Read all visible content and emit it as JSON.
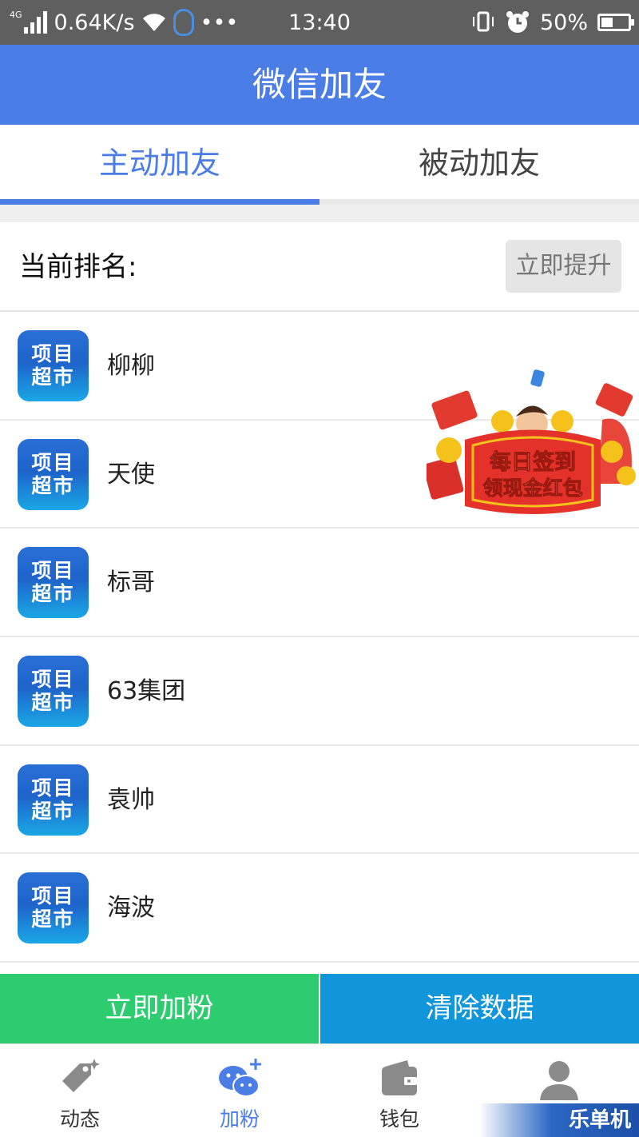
{
  "status_bar": {
    "network": "4G",
    "speed": "0.64K/s",
    "more": "•••",
    "time": "13:40",
    "battery": "50%",
    "battery_level": 0.5
  },
  "header": {
    "title": "微信加友"
  },
  "tabs": [
    {
      "label": "主动加友",
      "active": true
    },
    {
      "label": "被动加友",
      "active": false
    }
  ],
  "rank": {
    "label": "当前排名:",
    "button": "立即提升"
  },
  "list_logo_text": [
    "项目",
    "超市"
  ],
  "list": [
    {
      "name": "柳柳"
    },
    {
      "name": "天使"
    },
    {
      "name": "标哥"
    },
    {
      "name": "63集团"
    },
    {
      "name": "袁帅"
    },
    {
      "name": "海波"
    }
  ],
  "promo": {
    "line1": "每日签到",
    "line2": "领现金红包"
  },
  "actions": {
    "add_fans": "立即加粉",
    "clear_data": "清除数据"
  },
  "bottom_nav": [
    {
      "label": "动态",
      "icon": "tag-icon",
      "active": false
    },
    {
      "label": "加粉",
      "icon": "wechat-add-icon",
      "active": true
    },
    {
      "label": "钱包",
      "icon": "wallet-icon",
      "active": false
    },
    {
      "label": "",
      "icon": "person-icon",
      "active": false
    }
  ],
  "watermark": "乐单机",
  "colors": {
    "accent": "#4a7de6",
    "green": "#2dcc6f",
    "blue": "#1296db",
    "statusbar": "#5f5f5f"
  }
}
